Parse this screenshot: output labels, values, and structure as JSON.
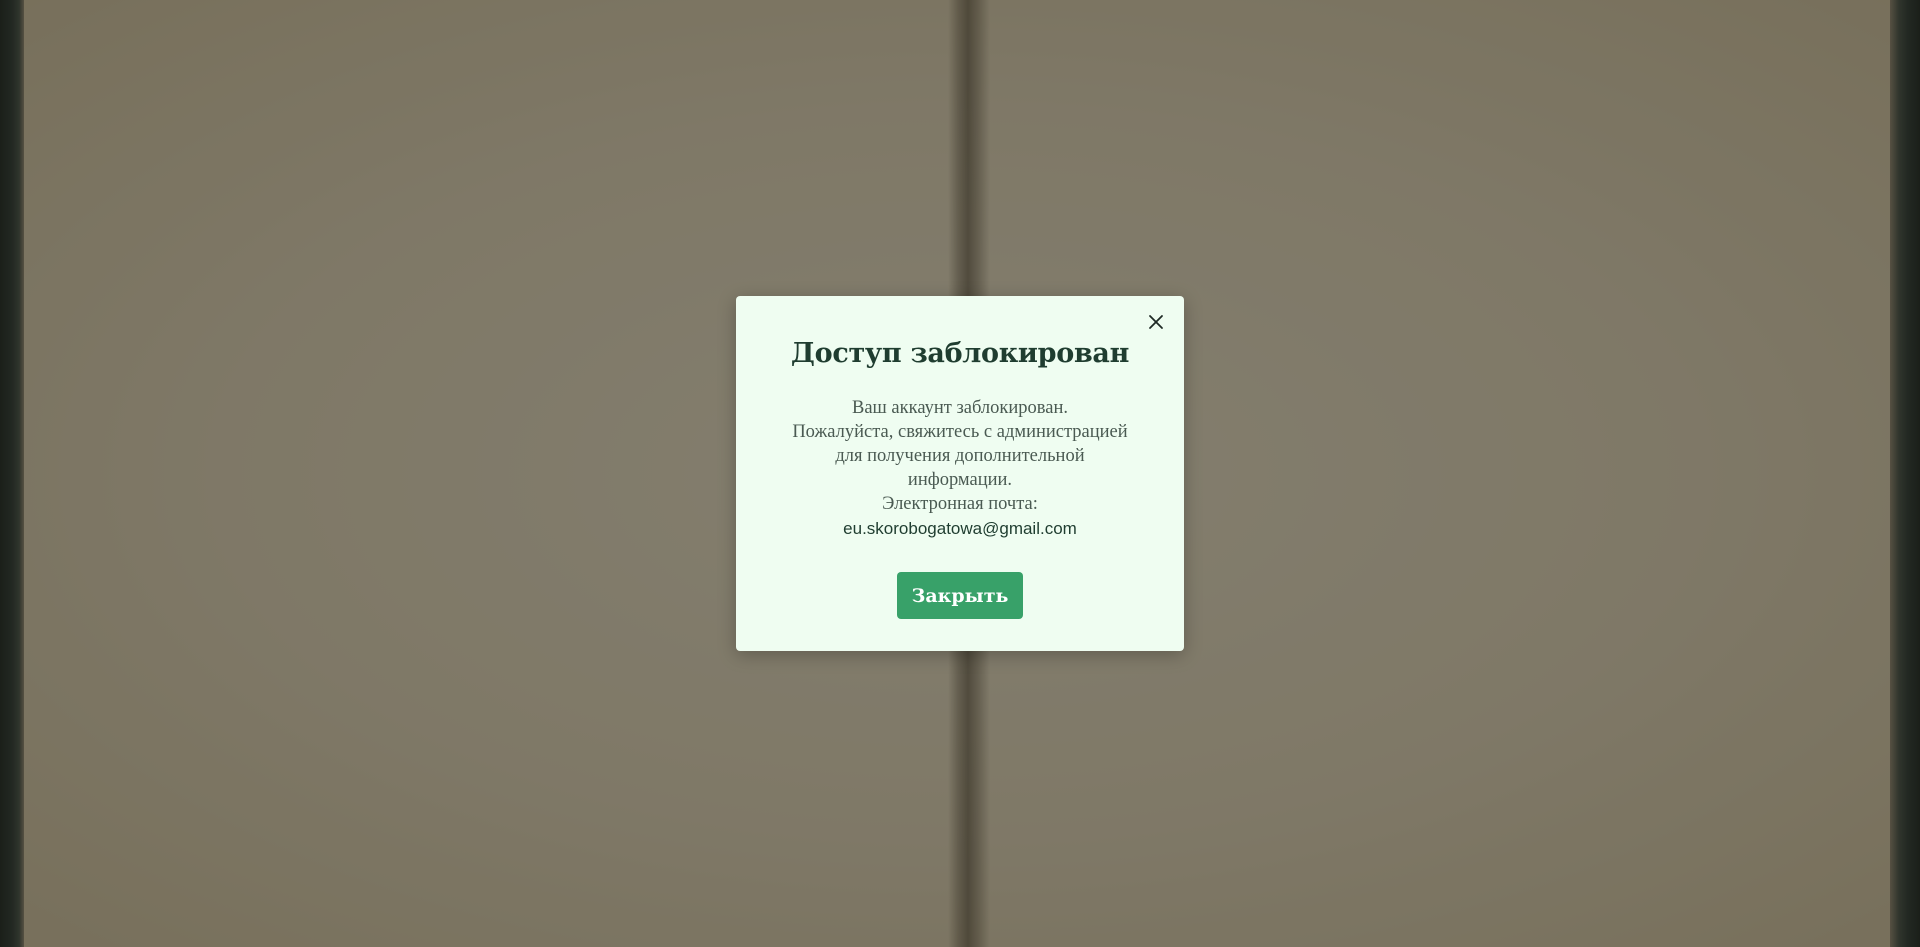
{
  "modal": {
    "title": "Доступ заблокирован",
    "message_lines": [
      "Ваш аккаунт заблокирован.",
      "Пожалуйста, свяжитесь с администрацией",
      "для получения дополнительной",
      "информации.",
      "Электронная почта:"
    ],
    "email": "eu.skorobogatowa@gmail.com",
    "close_button_label": "Закрыть",
    "close_icon": "close-icon"
  },
  "colors": {
    "modal_background": "#effdf1",
    "accent": "#38a169",
    "title": "#1f3d30",
    "overlay": "rgba(40, 38, 30, 0.55)"
  }
}
